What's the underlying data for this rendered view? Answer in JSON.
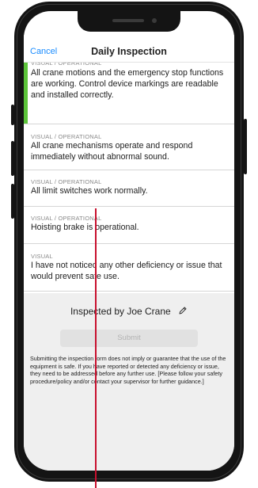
{
  "header": {
    "cancel_label": "Cancel",
    "title": "Daily Inspection"
  },
  "items": [
    {
      "category": "VISUAL / OPERATIONAL",
      "text": "All crane motions and the emergency stop functions are working. Control device markings are readable and installed correctly.",
      "has_indicator": true
    },
    {
      "category": "VISUAL / OPERATIONAL",
      "text": "All crane mechanisms operate and respond immediately without abnormal sound.",
      "has_indicator": true
    },
    {
      "category": "VISUAL / OPERATIONAL",
      "text": "All limit switches work normally.",
      "has_indicator": true
    },
    {
      "category": "VISUAL / OPERATIONAL",
      "text": "Hoisting brake is operational.",
      "has_indicator": true
    },
    {
      "category": "VISUAL",
      "text": "I have not noticed any other deficiency or issue that would prevent safe use.",
      "has_indicator": false
    }
  ],
  "footer": {
    "inspected_by": "Inspected by Joe Crane",
    "edit_icon": "pencil-icon",
    "submit_label": "Submit",
    "disclaimer": "Submitting the inspection form does not imply or guarantee that the use of the equipment is safe. If you have reported or detected any deficiency or issue, they need to be addressed before any further use. [Please follow your safety procedure/policy and/or contact your supervisor for further guidance.]"
  },
  "colors": {
    "accent": "#1a8cff",
    "indicator": "#5cc43a",
    "annotation": "#c8102e"
  }
}
